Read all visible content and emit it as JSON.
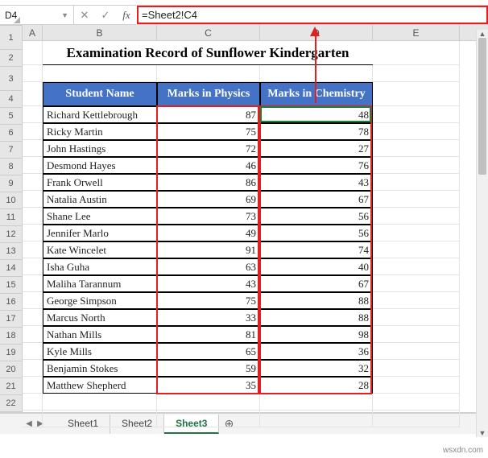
{
  "formula_bar": {
    "name_box": "D4",
    "formula": "=Sheet2!C4"
  },
  "columns": [
    "A",
    "B",
    "C",
    "D",
    "E"
  ],
  "row_numbers": [
    1,
    2,
    3,
    4,
    5,
    6,
    7,
    8,
    9,
    10,
    11,
    12,
    13,
    14,
    15,
    16,
    17,
    18,
    19,
    20,
    21,
    22
  ],
  "title": "Examination Record of Sunflower Kindergarten",
  "headers": {
    "name": "Student Name",
    "physics": "Marks in Physics",
    "chemistry": "Marks in Chemistry"
  },
  "students": [
    {
      "name": "Richard Kettlebrough",
      "physics": 87,
      "chemistry": 48
    },
    {
      "name": "Ricky Martin",
      "physics": 75,
      "chemistry": 78
    },
    {
      "name": "John Hastings",
      "physics": 72,
      "chemistry": 27
    },
    {
      "name": "Desmond Hayes",
      "physics": 46,
      "chemistry": 76
    },
    {
      "name": "Frank Orwell",
      "physics": 86,
      "chemistry": 43
    },
    {
      "name": "Natalia Austin",
      "physics": 69,
      "chemistry": 67
    },
    {
      "name": "Shane Lee",
      "physics": 73,
      "chemistry": 56
    },
    {
      "name": "Jennifer Marlo",
      "physics": 49,
      "chemistry": 56
    },
    {
      "name": "Kate Wincelet",
      "physics": 91,
      "chemistry": 74
    },
    {
      "name": "Isha Guha",
      "physics": 63,
      "chemistry": 40
    },
    {
      "name": "Maliha Tarannum",
      "physics": 43,
      "chemistry": 67
    },
    {
      "name": "George Simpson",
      "physics": 75,
      "chemistry": 88
    },
    {
      "name": "Marcus North",
      "physics": 33,
      "chemistry": 88
    },
    {
      "name": "Nathan Mills",
      "physics": 81,
      "chemistry": 98
    },
    {
      "name": "Kyle Mills",
      "physics": 65,
      "chemistry": 36
    },
    {
      "name": "Benjamin Stokes",
      "physics": 59,
      "chemistry": 32
    },
    {
      "name": "Matthew Shepherd",
      "physics": 35,
      "chemistry": 28
    }
  ],
  "tabs": {
    "items": [
      "Sheet1",
      "Sheet2",
      "Sheet3"
    ],
    "active": "Sheet3"
  },
  "watermark": "wsxdn.com"
}
